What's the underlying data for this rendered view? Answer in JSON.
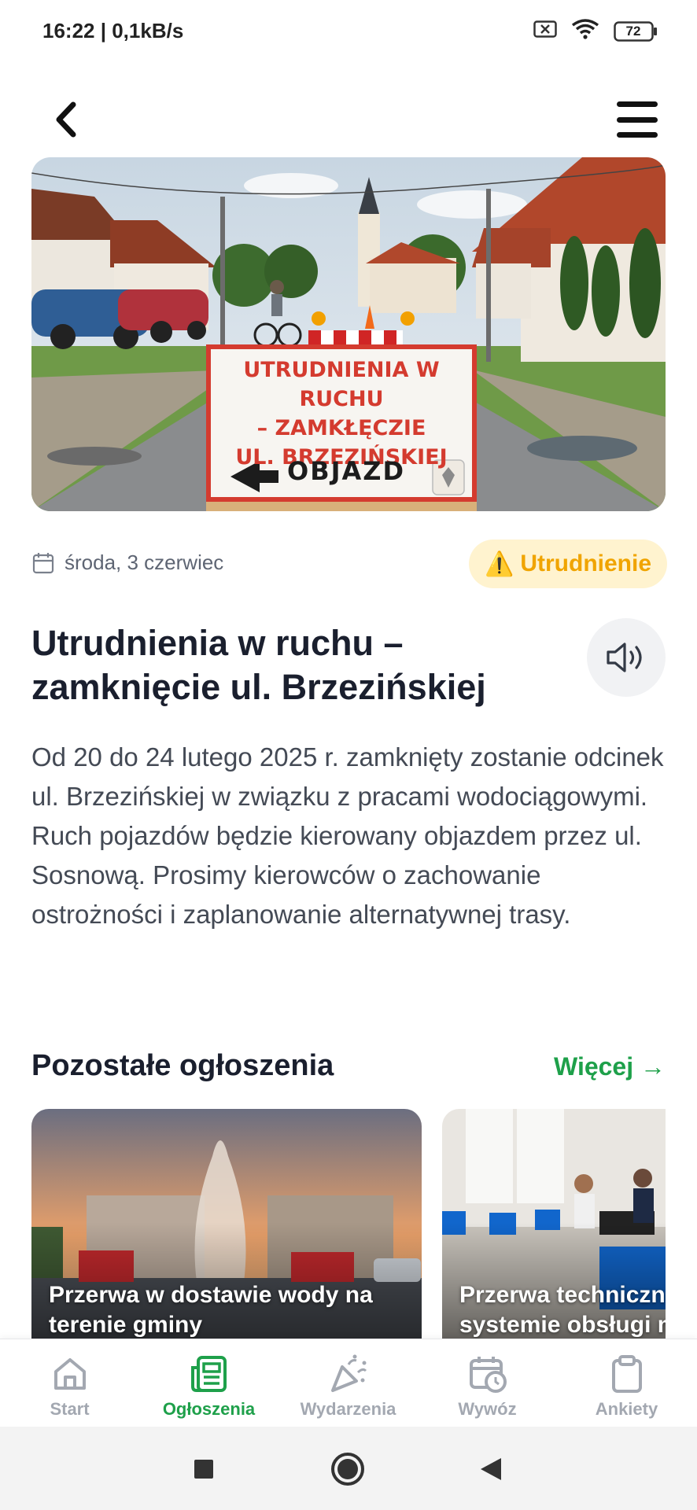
{
  "status_bar": {
    "time": "16:22 | 0,1kB/s",
    "battery": "72",
    "icons": [
      "sim-off-icon",
      "wifi-icon",
      "battery-icon"
    ]
  },
  "header": {
    "back_icon": "chevron-left-icon",
    "menu_icon": "hamburger-icon"
  },
  "hero": {
    "sign_lines": [
      "UTRUDNIENIA W RUCHU",
      "– ZAMKŁĘCZIE",
      "UL. BRZEZIŃSKIEJ"
    ],
    "sign_detour": "OBJAZD"
  },
  "article": {
    "date": "środa, 3 czerwiec",
    "badge_icon": "⚠️",
    "badge": "Utrudnienie",
    "title": "Utrudnienia w ruchu – zamknięcie ul. Brzezińskiej",
    "body_p1": "Od 20 do 24 lutego 2025 r. zamknięty zostanie odcinek ul. Brzezińskiej w związku z pracami wodociągowymi.",
    "body_p2": "Ruch pojazdów będzie kierowany objazdem przez ul. Sosnową. Prosimy kierowców o zachowanie ostrożności i zaplanowanie alternatywnej trasy."
  },
  "others": {
    "title": "Pozostałe ogłoszenia",
    "more": "Więcej →",
    "cards": [
      {
        "title_l1": "Przerwa w dostawie wody na",
        "title_l2": "terenie gminy"
      },
      {
        "title_l1": "Przerwa techniczn",
        "title_l2": "systemie obsługi m"
      }
    ]
  },
  "nav": {
    "items": [
      {
        "label": "Start",
        "icon": "home-icon"
      },
      {
        "label": "Ogłoszenia",
        "icon": "newspaper-icon"
      },
      {
        "label": "Wydarzenia",
        "icon": "party-icon"
      },
      {
        "label": "Wywóz",
        "icon": "calendar-clock-icon"
      },
      {
        "label": "Ankiety",
        "icon": "clipboard-icon"
      }
    ],
    "active": "Ogłoszenia"
  },
  "colors": {
    "accent": "#1ea04a",
    "badge_bg": "#fff3cf",
    "badge_text": "#f0a400",
    "muted": "#a3a8b1"
  }
}
